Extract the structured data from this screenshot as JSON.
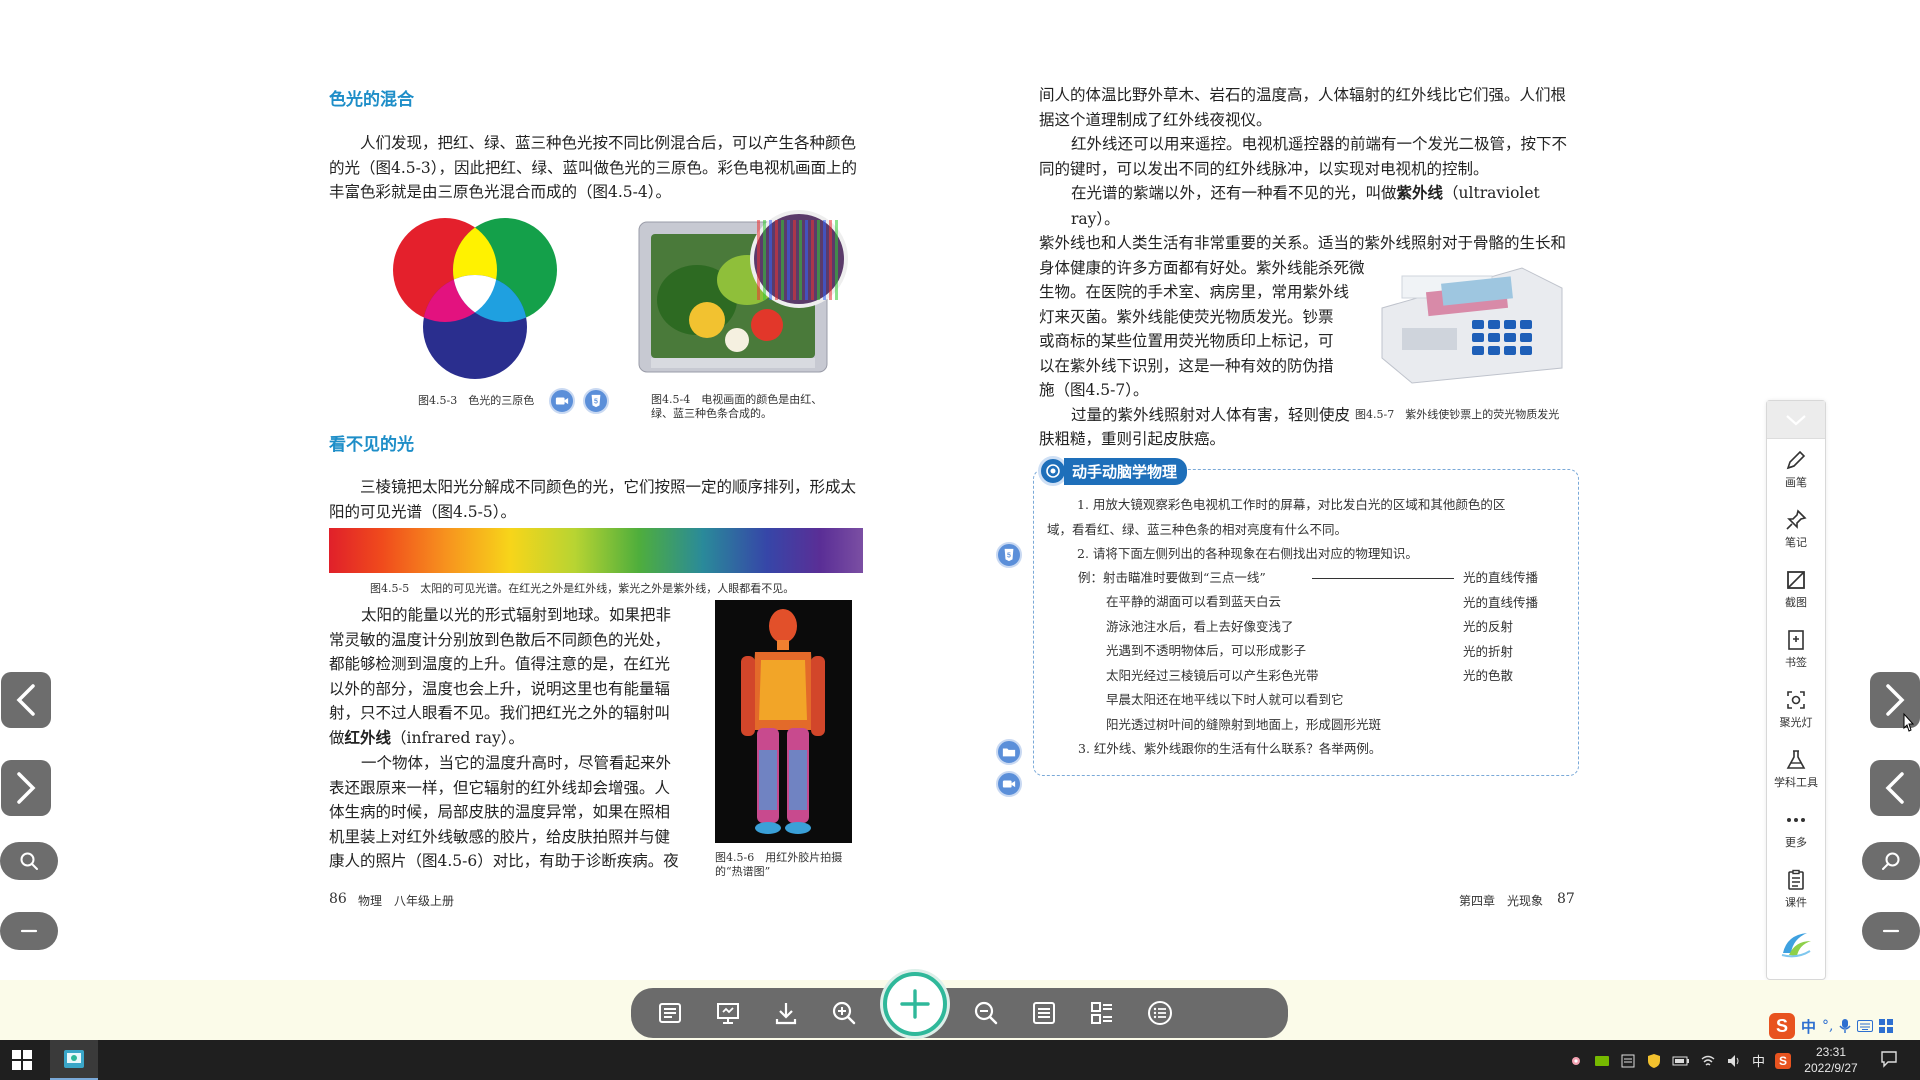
{
  "left_page": {
    "section1_title": "色光的混合",
    "section1_para": "人们发现，把红、绿、蓝三种色光按不同比例混合后，可以产生各种颜色的光（图4.5-3），因此把红、绿、蓝叫做色光的三原色。彩色电视机画面上的丰富色彩就是由三原色光混合而成的（图4.5-4）。",
    "fig3_caption": "图4.5-3　色光的三原色",
    "fig4_caption_1": "图4.5-4　电视画面的颜色是由红、",
    "fig4_caption_2": "绿、蓝三种色条合成的。",
    "section2_title": "看不见的光",
    "section2_para": "三棱镜把太阳光分解成不同颜色的光，它们按照一定的顺序排列，形成太阳的可见光谱（图4.5-5）。",
    "fig5_caption": "图4.5-5　太阳的可见光谱。在红光之外是红外线，紫光之外是紫外线，人眼都看不见。",
    "para3_lines": [
      "太阳的能量以光的形式辐射到地球。如果把非",
      "常灵敏的温度计分别放到色散后不同颜色的光处，",
      "都能够检测到温度的上升。值得注意的是，在红光",
      "以外的部分，温度也会上升，说明这里也有能量辐",
      "射，只不过人眼看不见。我们把红光之外的辐射叫"
    ],
    "para3_last_prefix": "做",
    "para3_term": "红外线",
    "para3_last_suffix": "（infrared ray）。",
    "para4_lines": [
      "一个物体，当它的温度升高时，尽管看起来外",
      "表还跟原来一样，但它辐射的红外线却会增强。人",
      "体生病的时候，局部皮肤的温度异常，如果在照相",
      "机里装上对红外线敏感的胶片，给皮肤拍照并与健",
      "康人的照片（图4.5-6）对比，有助于诊断疾病。夜"
    ],
    "fig6_caption_1": "图4.5-6　用红外胶片拍摄",
    "fig6_caption_2": "的“热谱图”",
    "footer_page": "86",
    "footer_book": "物理　八年级上册"
  },
  "right_page": {
    "para1_lines": [
      "间人的体温比野外草木、岩石的温度高，人体辐射的红外线比它们强。人们根",
      "据这个道理制成了红外线夜视仪。"
    ],
    "para2_lines": [
      "红外线还可以用来遥控。电视机遥控器的前端有一个发光二极管，按下不",
      "同的键时，可以发出不同的红外线脉冲，以实现对电视机的控制。"
    ],
    "para3_line1_prefix": "在光谱的紫端以外，还有一种看不见的光，叫做",
    "para3_term": "紫外线",
    "para3_line1_suffix": "（ultraviolet ray）。",
    "para3_lines": [
      "紫外线也和人类生活有非常重要的关系。适当的紫外线照射对于骨骼的生长和",
      "身体健康的许多方面都有好处。紫外线能杀死微",
      "生物。在医院的手术室、病房里，常用紫外线",
      "灯来灭菌。紫外线能使荧光物质发光。钞票",
      "或商标的某些位置用荧光物质印上标记，可",
      "以在紫外线下识别，这是一种有效的防伪措",
      "施（图4.5-7）。"
    ],
    "para4_lines": [
      "过量的紫外线照射对人体有害，轻则使皮",
      "肤粗糙，重则引起皮肤癌。"
    ],
    "fig7_caption": "图4.5-7　紫外线使钞票上的荧光物质发光",
    "activity_title": "动手动脑学物理",
    "activity_lines": [
      "1. 用放大镜观察彩色电视机工作时的屏幕，对比发白光的区域和其他颜色的区",
      "域，看看红、绿、蓝三种色条的相对亮度有什么不同。",
      "2. 请将下面左侧列出的各种现象在右侧找出对应的物理知识。"
    ],
    "example_left": "例：射击瞄准时要做到“三点一线”",
    "match_left": [
      "在平静的湖面可以看到蓝天白云",
      "游泳池注水后，看上去好像变浅了",
      "光遇到不透明物体后，可以形成影子",
      "太阳光经过三棱镜后可以产生彩色光带",
      "早晨太阳还在地平线以下时人就可以看到它",
      "阳光透过树叶间的缝隙射到地面上，形成圆形光斑"
    ],
    "match_right": [
      "光的直线传播",
      "光的直线传播",
      "光的反射",
      "光的折射",
      "光的色散"
    ],
    "question3": "3. 红外线、紫外线跟你的生活有什么联系？各举两例。",
    "footer_chapter": "第四章　光现象",
    "footer_page": "87"
  },
  "right_toolbar": {
    "items": [
      {
        "label": "画笔",
        "icon": "pen-icon"
      },
      {
        "label": "笔记",
        "icon": "pin-icon"
      },
      {
        "label": "截图",
        "icon": "crop-icon"
      },
      {
        "label": "书签",
        "icon": "bookmark-icon"
      },
      {
        "label": "聚光灯",
        "icon": "spotlight-icon"
      },
      {
        "label": "学科工具",
        "icon": "flask-icon"
      },
      {
        "label": "更多",
        "icon": "more-icon"
      },
      {
        "label": "课件",
        "icon": "courseware-icon"
      }
    ]
  },
  "taskbar": {
    "ime_label": "中",
    "time": "23:31",
    "date": "2022/9/27"
  },
  "ime_bar": {
    "lang": "中"
  },
  "colors": {
    "accent_blue": "#1e8ec8",
    "activity_blue": "#1e6fba",
    "toolbar_gray": "#6b6b6b",
    "plus_green": "#2fb89a"
  }
}
